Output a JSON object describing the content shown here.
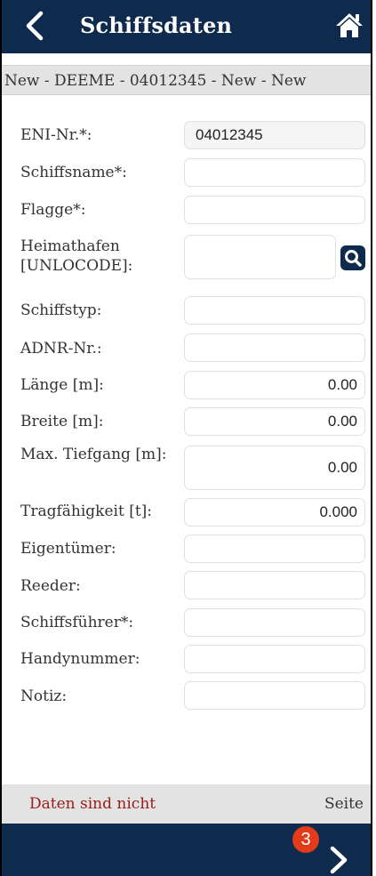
{
  "header": {
    "title": "Schiffsdaten",
    "back_icon": "chevron-left-icon",
    "home_icon": "home-icon"
  },
  "breadcrumb": "New - DEEME - 04012345 - New - New",
  "fields": [
    {
      "label": "ENI-Nr.*:",
      "value": "04012345"
    },
    {
      "label": "Schiffsname*:",
      "value": ""
    },
    {
      "label": "Flagge*:",
      "value": ""
    },
    {
      "label": "Heimathafen [UNLOCODE]:",
      "value": ""
    },
    {
      "label": "Schiffstyp:",
      "value": ""
    },
    {
      "label": "ADNR-Nr.:",
      "value": ""
    },
    {
      "label": "Länge [m]:",
      "value": "0.00"
    },
    {
      "label": "Breite [m]:",
      "value": "0.00"
    },
    {
      "label": "Max. Tiefgang [m]:",
      "value": "0.00"
    },
    {
      "label": "Tragfähigkeit [t]:",
      "value": "0.000"
    },
    {
      "label": "Eigentümer:",
      "value": ""
    },
    {
      "label": "Reeder:",
      "value": ""
    },
    {
      "label": "Schiffsführer*:",
      "value": ""
    },
    {
      "label": "Handynummer:",
      "value": ""
    },
    {
      "label": "Notiz:",
      "value": ""
    }
  ],
  "status": {
    "message": "Daten sind nicht",
    "page_label": "Seite"
  },
  "footer": {
    "badge_count": "3",
    "next_icon": "chevron-right-icon"
  },
  "colors": {
    "nav": "#0e2a4c",
    "warning_text": "#9b1b1b",
    "badge": "#e23b1a"
  }
}
